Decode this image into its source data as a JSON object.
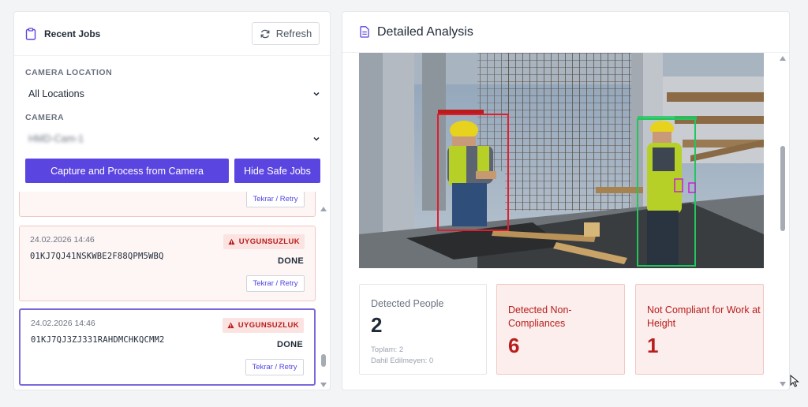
{
  "recent_jobs": {
    "title": "Recent Jobs",
    "refresh_label": "Refresh",
    "camera_location_label": "CAMERA LOCATION",
    "camera_location_value": "All Locations",
    "camera_label": "CAMERA",
    "camera_value": "HMD-Cam-1",
    "capture_button": "Capture and Process from Camera",
    "hide_safe_button": "Hide Safe Jobs",
    "jobs": [
      {
        "retry_label": "Tekrar / Retry"
      },
      {
        "date": "24.02.2026 14:46",
        "id": "01KJ7QJ41NSKWBE2F88QPM5WBQ",
        "badge": "UYGUNSUZLUK",
        "status": "DONE",
        "retry_label": "Tekrar / Retry"
      },
      {
        "date": "24.02.2026 14:46",
        "id": "01KJ7QJ3ZJ331RAHDMCHKQCMM2",
        "badge": "UYGUNSUZLUK",
        "status": "DONE",
        "retry_label": "Tekrar / Retry"
      }
    ],
    "scroll_position": 0.92
  },
  "analysis": {
    "title": "Detailed Analysis",
    "stats": [
      {
        "label": "Detected People",
        "value": "2",
        "sub1": "Toplam: 2",
        "sub2": "Dahil Edilmeyen: 0"
      },
      {
        "label": "Detected Non-Compliances",
        "value": "6"
      },
      {
        "label": "Not Compliant for Work at Height",
        "value": "1"
      }
    ],
    "scroll_position": 0.35
  },
  "colors": {
    "accent": "#5b45e0",
    "danger": "#b91c1c",
    "box_noncompliant": "#e11d2e",
    "box_compliant": "#22c55e"
  }
}
